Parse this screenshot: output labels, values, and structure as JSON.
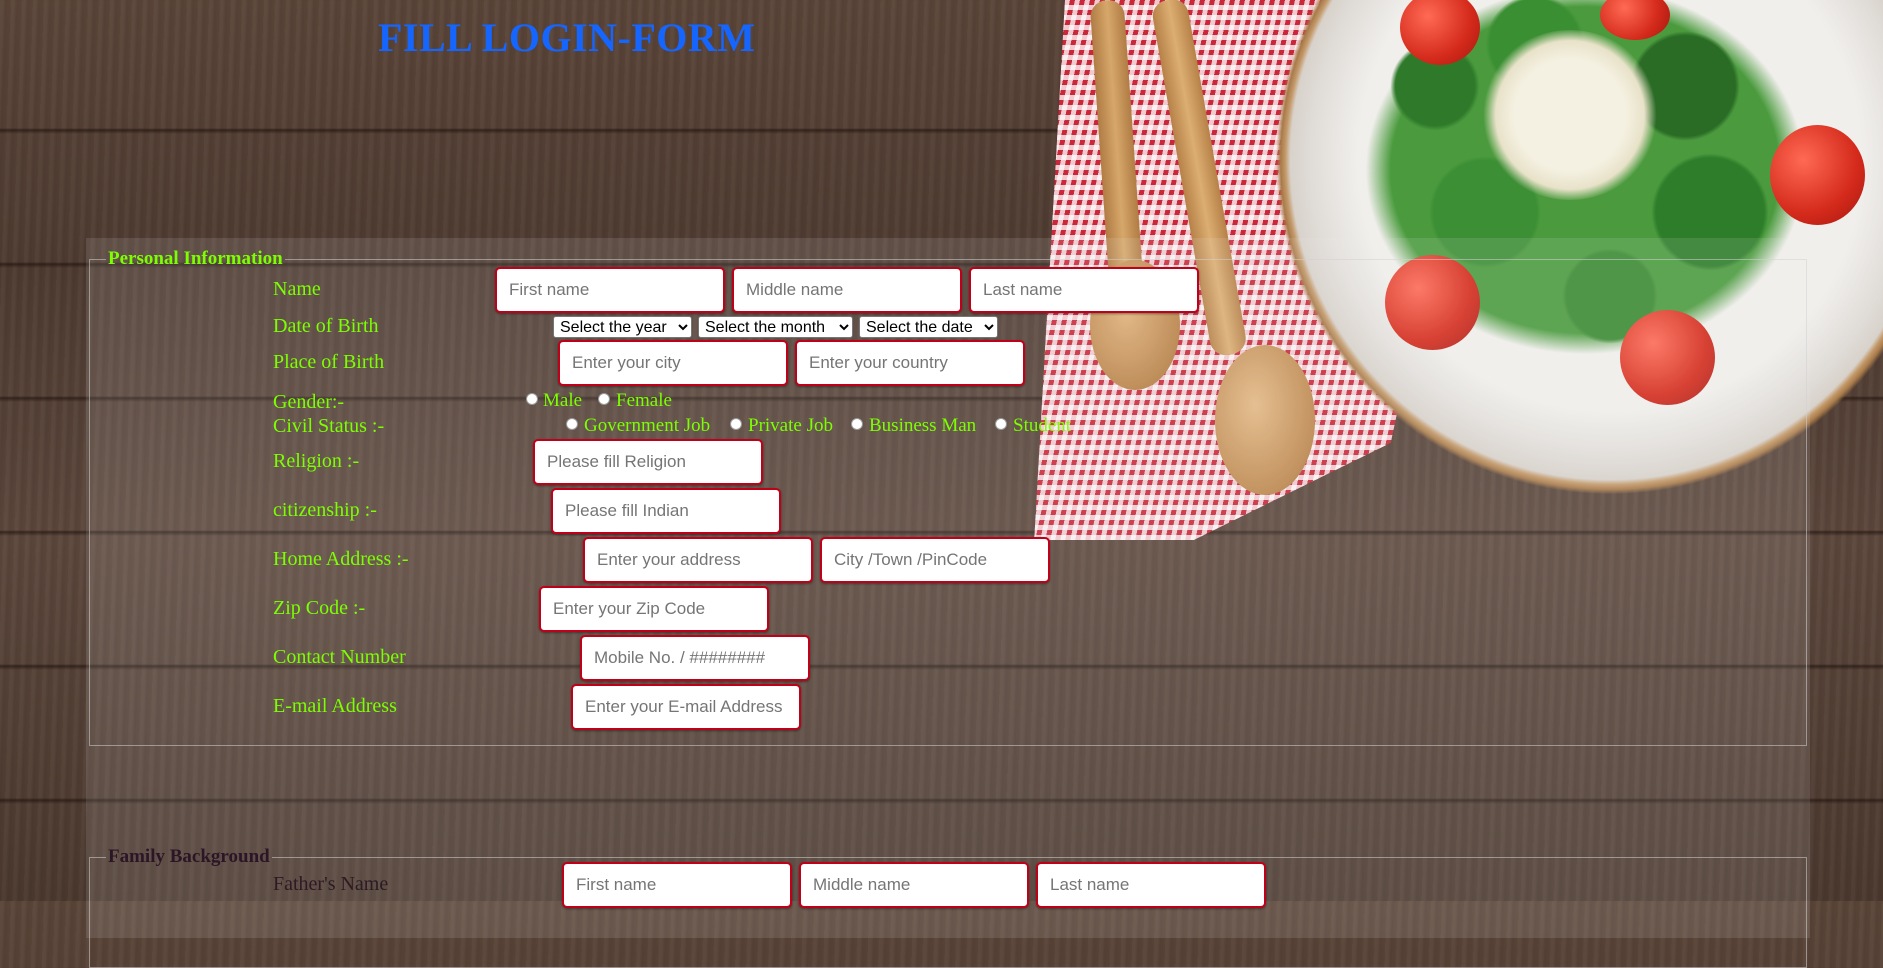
{
  "title": "FILL LOGIN-FORM",
  "personal": {
    "legend": "Personal Information",
    "labels": {
      "name": "Name",
      "dob": "Date of Birth",
      "pob": "Place of Birth",
      "gender": "Gender:-",
      "civil": "Civil Status :-",
      "religion": "Religion :-",
      "citizenship": "citizenship :-",
      "address": "Home Address :-",
      "zip": "Zip Code :-",
      "contact": "Contact Number",
      "email": "E-mail Address"
    },
    "placeholders": {
      "first": "First name",
      "middle": "Middle name",
      "last": "Last name",
      "city": "Enter your city",
      "country": "Enter your country",
      "religion": "Please fill Religion",
      "citizenship": "Please fill Indian",
      "address": "Enter your address",
      "city_town": "City /Town /PinCode",
      "zip": "Enter your Zip Code",
      "mobile": "Mobile No. / ########",
      "email": "Enter your E-mail Address (example@gmail.com)"
    },
    "dob_selects": {
      "year": "Select the year",
      "month": "Select the month",
      "date": "Select the date"
    },
    "gender_options": [
      "Male",
      "Female"
    ],
    "civil_options": [
      "Government Job",
      "Private Job",
      "Business Man",
      "Student"
    ]
  },
  "family": {
    "legend": "Family Background",
    "father_label": "Father's Name",
    "placeholders": {
      "first": "First name",
      "middle": "Middle name",
      "last": "Last name"
    }
  },
  "colors": {
    "title": "#1565ff",
    "label": "#7cff00",
    "input_border": "#c00018"
  }
}
